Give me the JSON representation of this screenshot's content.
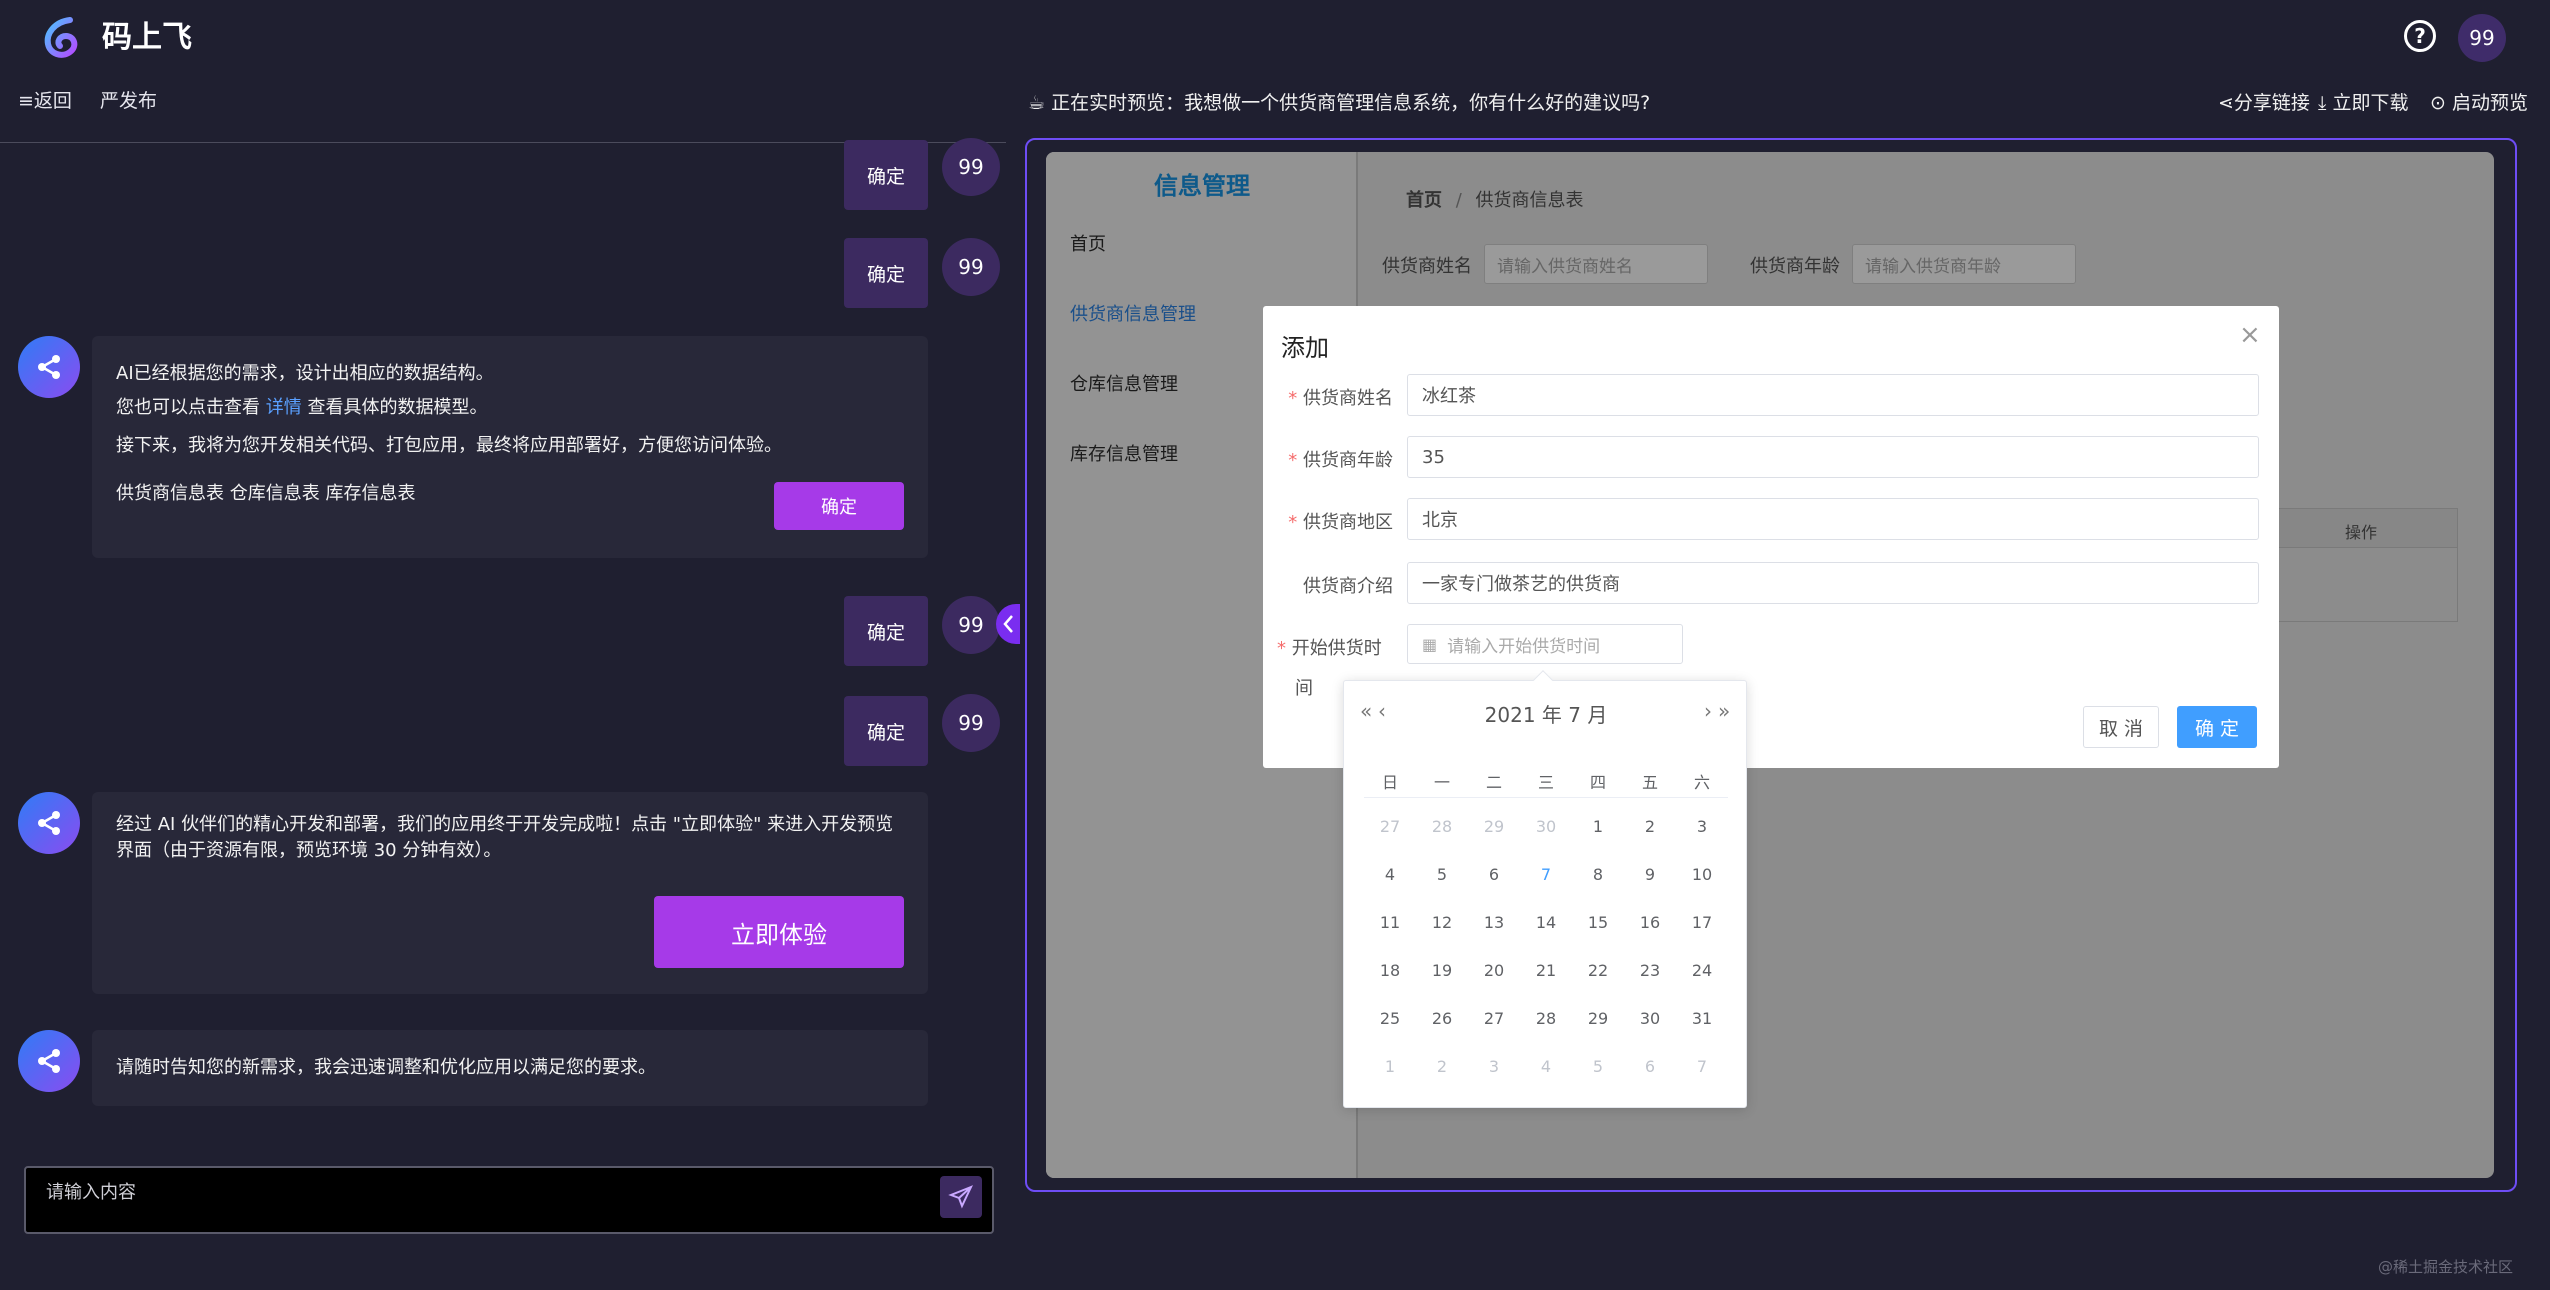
{
  "app": {
    "title": "码上飞",
    "avatar": "99"
  },
  "subnav": {
    "back": "≡返回",
    "publish": "严发布"
  },
  "chat": {
    "confirm_label": "确定",
    "user_avatar": "99",
    "bot1": {
      "line1": "AI已经根据您的需求，设计出相应的数据结构。",
      "line2_pre": "您也可以点击查看 ",
      "line2_link": "详情",
      "line2_post": " 查看具体的数据模型。",
      "line3": "接下来，我将为您开发相关代码、打包应用，最终将应用部署好，方便您访问体验。",
      "tables": "供货商信息表 仓库信息表 库存信息表",
      "button": "确定"
    },
    "bot2": {
      "text": "经过 AI 伙伴们的精心开发和部署，我们的应用终于开发完成啦！点击 \"立即体验\" 来进入开发预览界面（由于资源有限，预览环境 30 分钟有效）。",
      "button": "立即体验"
    },
    "bot3": {
      "text": "请随时告知您的新需求，我会迅速调整和优化应用以满足您的要求。"
    },
    "input_placeholder": "请输入内容"
  },
  "preview": {
    "title": "正在实时预览：我想做一个供货商管理信息系统，你有什么好的建议吗?",
    "share": "分享链接",
    "download": "立即下载",
    "launch": "启动预览"
  },
  "mock_app": {
    "sidebar_title": "信息管理",
    "menu": [
      "首页",
      "供货商信息管理",
      "仓库信息管理",
      "库存信息管理"
    ],
    "breadcrumb_home": "首页",
    "breadcrumb_sep": "/",
    "breadcrumb_current": "供货商信息表",
    "filter_name_label": "供货商姓名",
    "filter_name_placeholder": "请输入供货商姓名",
    "filter_age_label": "供货商年龄",
    "filter_age_placeholder": "请输入供货商年龄",
    "table_op": "操作"
  },
  "dialog": {
    "title": "添加",
    "close": "×",
    "fields": [
      {
        "label": "供货商姓名",
        "value": "冰红茶",
        "required": true
      },
      {
        "label": "供货商年龄",
        "value": "35",
        "required": true
      },
      {
        "label": "供货商地区",
        "value": "北京",
        "required": true
      },
      {
        "label": "供货商介绍",
        "value": "一家专门做茶艺的供货商",
        "required": false
      }
    ],
    "date_label_1": "开始供货时",
    "date_label_2": "间",
    "date_placeholder": "请输入开始供货时间",
    "cancel": "取 消",
    "ok": "确 定"
  },
  "datepicker": {
    "header": "2021 年  7 月",
    "prev_year": "«",
    "prev_month": "‹",
    "next_month": "›",
    "next_year": "»",
    "weekdays": [
      "日",
      "一",
      "二",
      "三",
      "四",
      "五",
      "六"
    ],
    "weeks": [
      [
        "27",
        "28",
        "29",
        "30",
        "1",
        "2",
        "3"
      ],
      [
        "4",
        "5",
        "6",
        "7",
        "8",
        "9",
        "10"
      ],
      [
        "11",
        "12",
        "13",
        "14",
        "15",
        "16",
        "17"
      ],
      [
        "18",
        "19",
        "20",
        "21",
        "22",
        "23",
        "24"
      ],
      [
        "25",
        "26",
        "27",
        "28",
        "29",
        "30",
        "31"
      ],
      [
        "1",
        "2",
        "3",
        "4",
        "5",
        "6",
        "7"
      ]
    ],
    "today": "7"
  },
  "watermark": "@稀土掘金技术社区",
  "colors": {
    "accent_purple": "#a63ae8",
    "primary_blue": "#409eff",
    "bg": "#1f1f30"
  }
}
